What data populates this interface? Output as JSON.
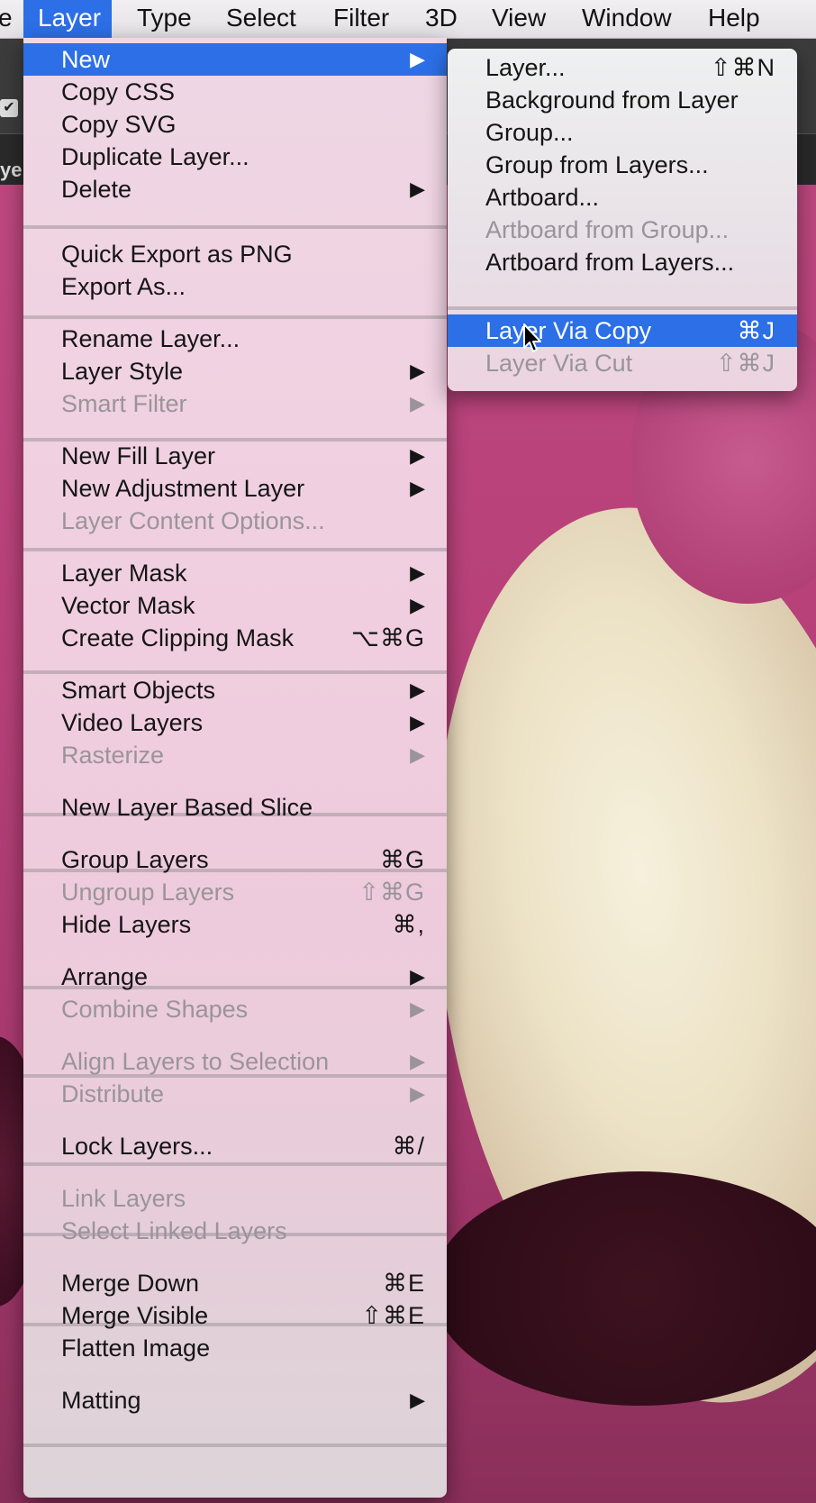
{
  "menubar": {
    "items": [
      {
        "label": "e"
      },
      {
        "label": "Layer"
      },
      {
        "label": "Type"
      },
      {
        "label": "Select"
      },
      {
        "label": "Filter"
      },
      {
        "label": "3D"
      },
      {
        "label": "View"
      },
      {
        "label": "Window"
      },
      {
        "label": "Help"
      }
    ]
  },
  "toolbar": {
    "layer_text": "yer"
  },
  "layer_menu": {
    "items": [
      {
        "label": "New"
      },
      {
        "label": "Copy CSS"
      },
      {
        "label": "Copy SVG"
      },
      {
        "label": "Duplicate Layer..."
      },
      {
        "label": "Delete"
      },
      {
        "label": "Quick Export as PNG"
      },
      {
        "label": "Export As..."
      },
      {
        "label": "Rename Layer..."
      },
      {
        "label": "Layer Style"
      },
      {
        "label": "Smart Filter"
      },
      {
        "label": "New Fill Layer"
      },
      {
        "label": "New Adjustment Layer"
      },
      {
        "label": "Layer Content Options..."
      },
      {
        "label": "Layer Mask"
      },
      {
        "label": "Vector Mask"
      },
      {
        "label": "Create Clipping Mask",
        "shortcut": "⌥⌘G"
      },
      {
        "label": "Smart Objects"
      },
      {
        "label": "Video Layers"
      },
      {
        "label": "Rasterize"
      },
      {
        "label": "New Layer Based Slice"
      },
      {
        "label": "Group Layers",
        "shortcut": "⌘G"
      },
      {
        "label": "Ungroup Layers",
        "shortcut": "⇧⌘G"
      },
      {
        "label": "Hide Layers",
        "shortcut": "⌘,"
      },
      {
        "label": "Arrange"
      },
      {
        "label": "Combine Shapes"
      },
      {
        "label": "Align Layers to Selection"
      },
      {
        "label": "Distribute"
      },
      {
        "label": "Lock Layers...",
        "shortcut": "⌘/"
      },
      {
        "label": "Link Layers"
      },
      {
        "label": "Select Linked Layers"
      },
      {
        "label": "Merge Down",
        "shortcut": "⌘E"
      },
      {
        "label": "Merge Visible",
        "shortcut": "⇧⌘E"
      },
      {
        "label": "Flatten Image"
      },
      {
        "label": "Matting"
      }
    ],
    "arrow": "▶"
  },
  "new_submenu": {
    "items": [
      {
        "label": "Layer...",
        "shortcut": "⇧⌘N"
      },
      {
        "label": "Background from Layer"
      },
      {
        "label": "Group..."
      },
      {
        "label": "Group from Layers..."
      },
      {
        "label": "Artboard..."
      },
      {
        "label": "Artboard from Group..."
      },
      {
        "label": "Artboard from Layers..."
      },
      {
        "label": "Layer Via Copy",
        "shortcut": "⌘J"
      },
      {
        "label": "Layer Via Cut",
        "shortcut": "⇧⌘J"
      }
    ]
  },
  "colors": {
    "highlight": "#2c6fe6",
    "disabled_text": "#9a949a"
  }
}
